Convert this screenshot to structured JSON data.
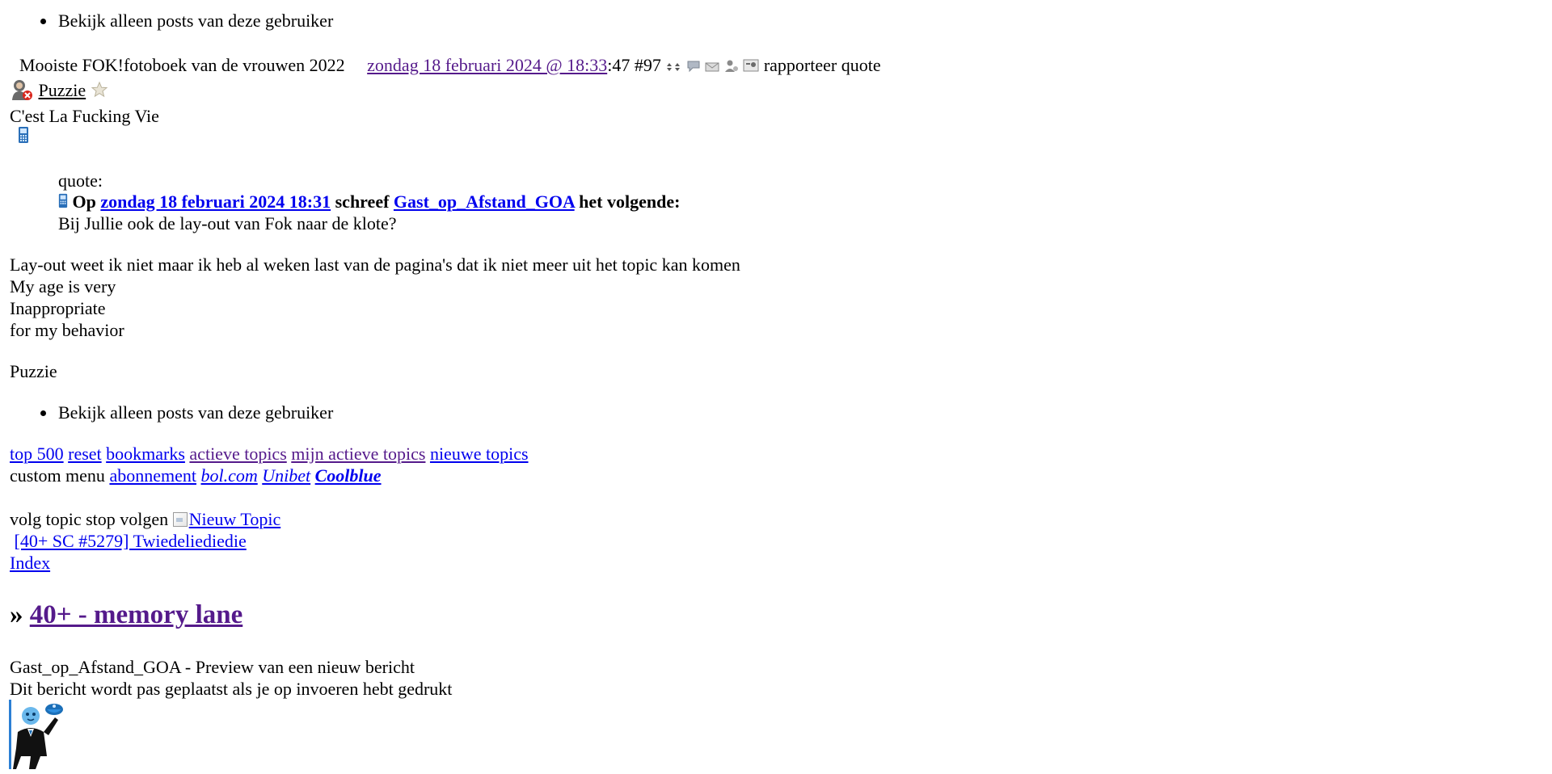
{
  "post_top": {
    "view_only_posts": "Bekijk alleen posts van deze gebruiker"
  },
  "post_header": {
    "title": "Mooiste FOK!fotoboek van de vrouwen 2022",
    "date_link": "zondag 18 februari 2024 @ 18:33",
    "seconds_and_number": ":47 #97",
    "report": "rapporteer",
    "quote": "quote"
  },
  "user": {
    "name": "Puzzie",
    "tagline": "C'est La Fucking Vie"
  },
  "quote_block": {
    "label": "quote:",
    "prefix": "Op",
    "date_link": "zondag 18 februari 2024 18:31",
    "wrote": "schreef",
    "author_link": "Gast_op_Afstand_GOA",
    "suffix": "het volgende:",
    "text": "Bij Jullie ook de lay-out van Fok naar de klote?"
  },
  "post_body": {
    "line1": "Lay-out weet ik niet maar ik heb al weken last van de pagina's dat ik niet meer uit het topic kan komen",
    "sig_line1": "My age is very",
    "sig_line2": "Inappropriate",
    "sig_line3": "for my behavior",
    "sig_name": "Puzzie"
  },
  "post_bottom": {
    "view_only_posts": "Bekijk alleen posts van deze gebruiker"
  },
  "nav": {
    "links": [
      "top 500",
      "reset",
      "bookmarks",
      "actieve topics",
      "mijn actieve topics",
      "nieuwe topics"
    ],
    "custom_menu_label": "custom menu",
    "custom_links": [
      "abonnement",
      "bol.com",
      "Unibet",
      "Coolblue"
    ]
  },
  "topic_actions": {
    "follow": "volg topic",
    "stop_follow": "stop volgen",
    "new_topic": "Nieuw Topic",
    "prev_topic": "[40+ SC #5279] Twiedeliediedie",
    "index": "Index"
  },
  "forum": {
    "arrow": "»",
    "title": "40+ - memory lane"
  },
  "preview": {
    "line1": "Gast_op_Afstand_GOA - Preview van een nieuw bericht",
    "line2": "Dit bericht wordt pas geplaatst als je op invoeren hebt gedrukt"
  },
  "icons": {
    "arrows": "updown-arrows-icon",
    "comment": "comment-icon",
    "mail": "mail-icon",
    "user": "user-icon",
    "card": "card-icon",
    "avatar": "user-status-icon",
    "star": "star-icon",
    "mobile": "mobile-phone-icon",
    "mascot": "butler-mascot-icon"
  },
  "colors": {
    "link": "#0000ee",
    "visited": "#551a8b",
    "accent_bar": "#2b7fd4"
  }
}
